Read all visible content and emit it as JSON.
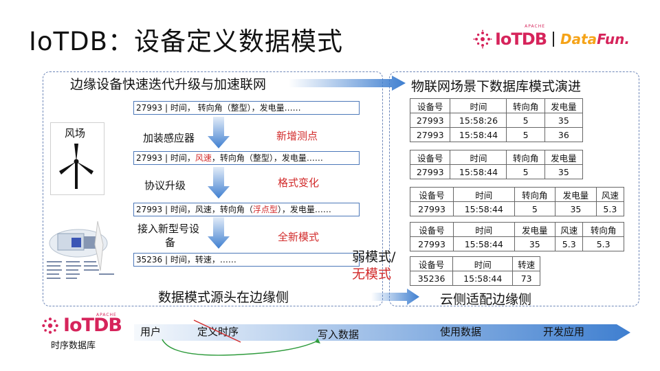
{
  "title": "IoTDB：设备定义数据模式",
  "logos": {
    "iotdb": "IoTDB",
    "apache": "APACHE",
    "datafun_a": "Data",
    "datafun_b": "Fun."
  },
  "left": {
    "title": "边缘设备快速迭代升级与加速联网",
    "site": "风场",
    "records": [
      {
        "parts": [
          "27993 | 时间， 转向角（整型），发电量……"
        ]
      },
      {
        "parts": [
          "27993 | 时间，",
          "风速",
          "，转向角（整型），发电量……"
        ]
      },
      {
        "parts": [
          "27993 | 时间，风速，转向角（",
          "浮点型",
          "），发电量……"
        ]
      },
      {
        "parts": [
          "35236 | 时间，转速，……"
        ]
      }
    ],
    "steps": [
      {
        "action": "加装感应器",
        "effect": "新增测点"
      },
      {
        "action": "协议升级",
        "effect": "格式变化"
      },
      {
        "action_line1": "接入新型号设",
        "action_line2": "备",
        "effect": "全新模式"
      }
    ],
    "bottom": "数据模式源头在边缘侧"
  },
  "middle": {
    "line1": "弱模式/",
    "line2": "无模式"
  },
  "right": {
    "title": "物联网场景下数据库模式演进",
    "tables": [
      {
        "header": [
          "设备号",
          "时间",
          "转向角",
          "发电量"
        ],
        "rows": [
          [
            "27993",
            "15:58:26",
            "5",
            "35"
          ],
          [
            "27993",
            "15:58:44",
            "5",
            "36"
          ]
        ]
      },
      {
        "header": [
          "设备号",
          "时间",
          "转向角",
          "发电量"
        ],
        "rows": [
          [
            "27993",
            "15:58:44",
            "5",
            "35"
          ]
        ]
      },
      {
        "header": [
          "设备号",
          "时间",
          "转向角",
          "发电量",
          "风速"
        ],
        "rows": [
          [
            "27993",
            "15:58:44",
            "5",
            "35",
            "5.3"
          ]
        ]
      },
      {
        "header": [
          "设备号",
          "时间",
          "发电量",
          "风速",
          "转向角"
        ],
        "rows": [
          [
            "27993",
            "15:58:44",
            "35",
            "5.3",
            "5.3"
          ]
        ]
      },
      {
        "header": [
          "设备号",
          "时间",
          "转速"
        ],
        "rows": [
          [
            "35236",
            "15:58:44",
            "73"
          ]
        ]
      }
    ],
    "bottom": "云侧适配边缘侧"
  },
  "footer": {
    "subtitle": "时序数据库",
    "flow": [
      "用户",
      "定义时序",
      "写入数据",
      "使用数据",
      "开发应用"
    ]
  },
  "colors": {
    "accent_red": "#d22b2b",
    "brand_pink": "#d6245b",
    "arrow_blue": "#3f7fd0",
    "panel_border": "#6d86b8"
  }
}
